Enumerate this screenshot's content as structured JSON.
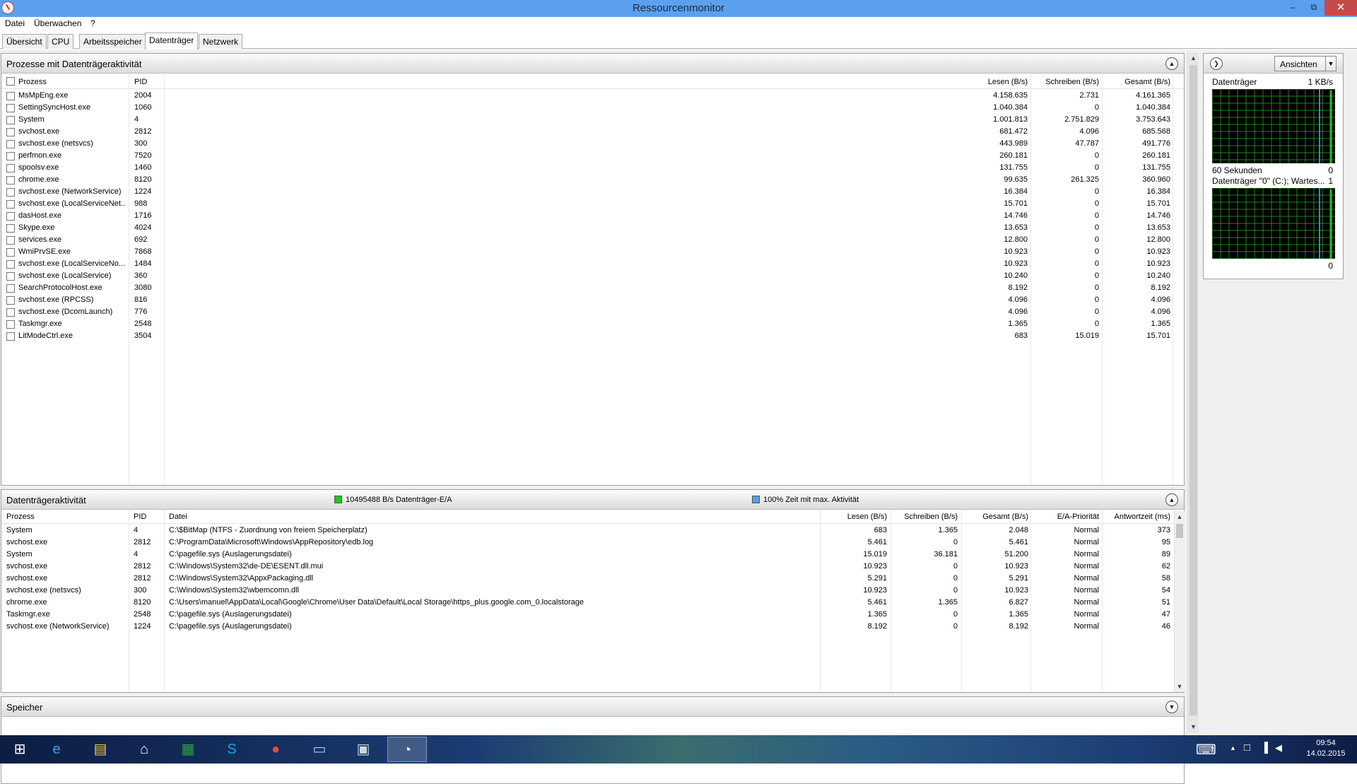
{
  "window": {
    "title": "Ressourcenmonitor",
    "minimize": "–",
    "restore": "⧉",
    "close": "✕"
  },
  "menu": [
    "Datei",
    "Überwachen",
    "?"
  ],
  "tabs": [
    {
      "label": "Übersicht",
      "active": false
    },
    {
      "label": "CPU",
      "active": false
    },
    {
      "label": "Arbeitsspeicher",
      "active": false
    },
    {
      "label": "Datenträger",
      "active": true
    },
    {
      "label": "Netzwerk",
      "active": false
    }
  ],
  "processes": {
    "title": "Prozesse mit Datenträgeraktivität",
    "collapse_glyph": "▲",
    "columns": [
      "Prozess",
      "PID",
      "Lesen (B/s)",
      "Schreiben (B/s)",
      "Gesamt (B/s)"
    ],
    "rows": [
      [
        "MsMpEng.exe",
        "2004",
        "4.158.635",
        "2.731",
        "4.161.365"
      ],
      [
        "SettingSyncHost.exe",
        "1060",
        "1.040.384",
        "0",
        "1.040.384"
      ],
      [
        "System",
        "4",
        "1.001.813",
        "2.751.829",
        "3.753.643"
      ],
      [
        "svchost.exe",
        "2812",
        "681.472",
        "4.096",
        "685.568"
      ],
      [
        "svchost.exe (netsvcs)",
        "300",
        "443.989",
        "47.787",
        "491.776"
      ],
      [
        "perfmon.exe",
        "7520",
        "260.181",
        "0",
        "260.181"
      ],
      [
        "spoolsv.exe",
        "1460",
        "131.755",
        "0",
        "131.755"
      ],
      [
        "chrome.exe",
        "8120",
        "99.635",
        "261.325",
        "360.960"
      ],
      [
        "svchost.exe (NetworkService)",
        "1224",
        "16.384",
        "0",
        "16.384"
      ],
      [
        "svchost.exe (LocalServiceNet...",
        "988",
        "15.701",
        "0",
        "15.701"
      ],
      [
        "dasHost.exe",
        "1716",
        "14.746",
        "0",
        "14.746"
      ],
      [
        "Skype.exe",
        "4024",
        "13.653",
        "0",
        "13.653"
      ],
      [
        "services.exe",
        "692",
        "12.800",
        "0",
        "12.800"
      ],
      [
        "WmiPrvSE.exe",
        "7868",
        "10.923",
        "0",
        "10.923"
      ],
      [
        "svchost.exe (LocalServiceNo...",
        "1484",
        "10.923",
        "0",
        "10.923"
      ],
      [
        "svchost.exe (LocalService)",
        "360",
        "10.240",
        "0",
        "10.240"
      ],
      [
        "SearchProtocolHost.exe",
        "3080",
        "8.192",
        "0",
        "8.192"
      ],
      [
        "svchost.exe (RPCSS)",
        "816",
        "4.096",
        "0",
        "4.096"
      ],
      [
        "svchost.exe (DcomLaunch)",
        "776",
        "4.096",
        "0",
        "4.096"
      ],
      [
        "Taskmgr.exe",
        "2548",
        "1.365",
        "0",
        "1.365"
      ],
      [
        "LitModeCtrl.exe",
        "3504",
        "683",
        "15.019",
        "15.701"
      ]
    ]
  },
  "activity": {
    "title": "Datenträgeraktivität",
    "io_label": "10495488 B/s Datenträger-E/A",
    "io_color": "#22c322",
    "time_label": "100% Zeit mit max. Aktivität",
    "time_color": "#5b9be0",
    "collapse_glyph": "▲",
    "scroll_up": "▲",
    "scroll_down": "▼",
    "columns": [
      "Prozess",
      "PID",
      "Datei",
      "Lesen (B/s)",
      "Schreiben (B/s)",
      "Gesamt (B/s)",
      "E/A-Priorität",
      "Antwortzeit (ms)"
    ],
    "rows": [
      [
        "System",
        "4",
        "C:\\$BitMap (NTFS - Zuordnung von freiem Speicherplatz)",
        "683",
        "1.365",
        "2.048",
        "Normal",
        "373"
      ],
      [
        "svchost.exe",
        "2812",
        "C:\\ProgramData\\Microsoft\\Windows\\AppRepository\\edb.log",
        "5.461",
        "0",
        "5.461",
        "Normal",
        "95"
      ],
      [
        "System",
        "4",
        "C:\\pagefile.sys (Auslagerungsdatei)",
        "15.019",
        "36.181",
        "51.200",
        "Normal",
        "89"
      ],
      [
        "svchost.exe",
        "2812",
        "C:\\Windows\\System32\\de-DE\\ESENT.dll.mui",
        "10.923",
        "0",
        "10.923",
        "Normal",
        "62"
      ],
      [
        "svchost.exe",
        "2812",
        "C:\\Windows\\System32\\AppxPackaging.dll",
        "5.291",
        "0",
        "5.291",
        "Normal",
        "58"
      ],
      [
        "svchost.exe (netsvcs)",
        "300",
        "C:\\Windows\\System32\\wbemcomn.dll",
        "10.923",
        "0",
        "10.923",
        "Normal",
        "54"
      ],
      [
        "chrome.exe",
        "8120",
        "C:\\Users\\manuel\\AppData\\Local\\Google\\Chrome\\User Data\\Default\\Local Storage\\https_plus.google.com_0.localstorage",
        "5.461",
        "1.365",
        "6.827",
        "Normal",
        "51"
      ],
      [
        "Taskmgr.exe",
        "2548",
        "C:\\pagefile.sys (Auslagerungsdatei)",
        "1.365",
        "0",
        "1.365",
        "Normal",
        "47"
      ],
      [
        "svchost.exe (NetworkService)",
        "1224",
        "C:\\pagefile.sys (Auslagerungsdatei)",
        "8.192",
        "0",
        "8.192",
        "Normal",
        "46"
      ]
    ]
  },
  "memory": {
    "title": "Speicher",
    "expand_glyph": "▼"
  },
  "side": {
    "nav_glyph": "❯",
    "views_label": "Ansichten",
    "views_arrow": "▼",
    "graph1": {
      "title": "Datenträger",
      "max": "1 KB/s",
      "footer_left": "60 Sekunden",
      "footer_right": "0",
      "color_background": "#000000",
      "color_grid": "#1d8a1d"
    },
    "graph2": {
      "title": "Datenträger \"0\" (C:); Wartes...",
      "max": "1",
      "footer_right": "0"
    }
  },
  "taskbar": {
    "start_glyph": "⊞",
    "icons": [
      {
        "name": "internet-explorer-icon",
        "glyph": "e",
        "color": "#3aa0e8"
      },
      {
        "name": "file-explorer-icon",
        "glyph": "▤",
        "color": "#f2c94c"
      },
      {
        "name": "home-icon",
        "glyph": "⌂",
        "color": "#ffffff"
      },
      {
        "name": "store-icon",
        "glyph": "▦",
        "color": "#2ea043"
      },
      {
        "name": "skype-icon",
        "glyph": "S",
        "color": "#19a2e6"
      },
      {
        "name": "chrome-icon",
        "glyph": "●",
        "color": "#e24c3b"
      },
      {
        "name": "notes-icon",
        "glyph": "▭",
        "color": "#9fd0e8"
      },
      {
        "name": "network-app-icon",
        "glyph": "▣",
        "color": "#cfd8dc"
      },
      {
        "name": "resource-monitor-icon",
        "glyph": "◔",
        "color": "#ffffff"
      }
    ],
    "tray": {
      "keyboard_glyph": "⌨",
      "overflow_glyph": "▲",
      "notify_glyph": "□",
      "signal_glyph": "▐",
      "volume_glyph": "◀",
      "time": "09:54",
      "date": "14.02.2015"
    }
  }
}
